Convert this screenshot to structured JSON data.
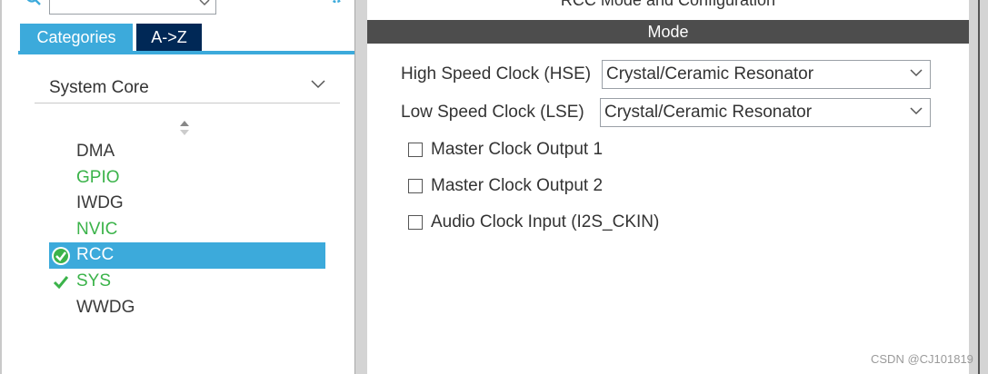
{
  "left": {
    "tabs": [
      {
        "label": "Categories"
      },
      {
        "label": "A->Z"
      }
    ],
    "category": "System Core",
    "items": [
      {
        "label": "DMA",
        "state": "plain"
      },
      {
        "label": "GPIO",
        "state": "green"
      },
      {
        "label": "IWDG",
        "state": "plain"
      },
      {
        "label": "NVIC",
        "state": "green"
      },
      {
        "label": "RCC",
        "state": "selected"
      },
      {
        "label": "SYS",
        "state": "checked"
      },
      {
        "label": "WWDG",
        "state": "plain"
      }
    ]
  },
  "right": {
    "title": "RCC Mode and Configuration",
    "mode_label": "Mode",
    "hse": {
      "label": "High Speed Clock (HSE)",
      "value": "Crystal/Ceramic Resonator"
    },
    "lse": {
      "label": "Low Speed Clock (LSE)",
      "value": "Crystal/Ceramic Resonator"
    },
    "checkboxes": [
      {
        "label": "Master Clock Output 1",
        "checked": false
      },
      {
        "label": "Master Clock Output 2",
        "checked": false
      },
      {
        "label": "Audio Clock Input (I2S_CKIN)",
        "checked": false
      }
    ]
  },
  "watermark": "CSDN @CJ101819",
  "colors": {
    "accent": "#3caadb",
    "tab_dark": "#002856",
    "mode_bar": "#4d4d4d",
    "green": "#3bb34a"
  }
}
